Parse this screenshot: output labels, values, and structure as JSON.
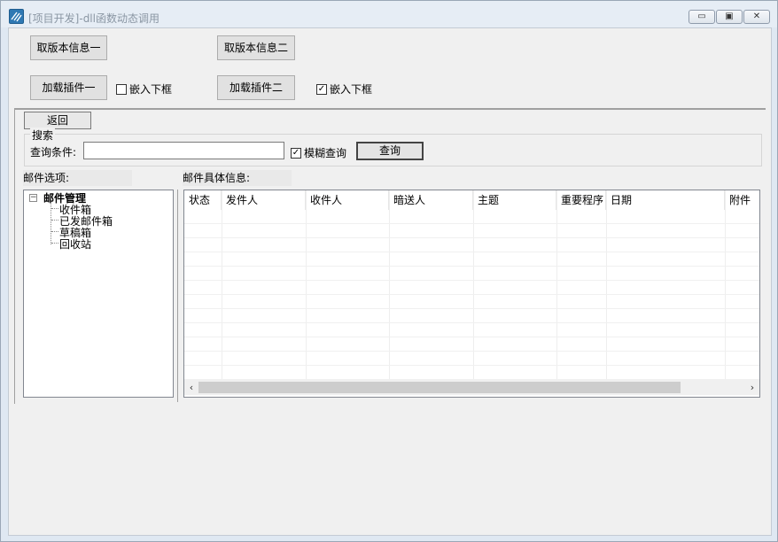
{
  "window": {
    "title": "[项目开发]-dll函数动态调用",
    "minimize_glyph": "▭",
    "restore_glyph": "▣",
    "close_glyph": "✕"
  },
  "top": {
    "get_version_1": "取版本信息一",
    "get_version_2": "取版本信息二",
    "load_plugin_1": "加载插件一",
    "load_plugin_2": "加载插件二",
    "embed_frame_1": {
      "label": "嵌入下框",
      "checked": false
    },
    "embed_frame_2": {
      "label": "嵌入下框",
      "checked": true
    }
  },
  "panel": {
    "back_label": "返回",
    "search_group_title": "搜索",
    "query_label": "查询条件:",
    "query_value": "",
    "fuzzy_query": {
      "label": "模糊查询",
      "checked": true
    },
    "query_button": "查询"
  },
  "mail_options": {
    "label": "邮件选项:",
    "tree": {
      "root": "邮件管理",
      "expander": "−",
      "items": [
        "收件箱",
        "已发邮件箱",
        "草稿箱",
        "回收站"
      ]
    }
  },
  "mail_detail": {
    "label": "邮件具体信息:",
    "columns": [
      "状态",
      "发件人",
      "收件人",
      "暗送人",
      "主题",
      "重要程序",
      "日期",
      "附件"
    ]
  },
  "scrollbar": {
    "left_arrow": "‹",
    "right_arrow": "›"
  },
  "icons": {
    "app": "app-logo-icon",
    "checkmark": "✓"
  }
}
